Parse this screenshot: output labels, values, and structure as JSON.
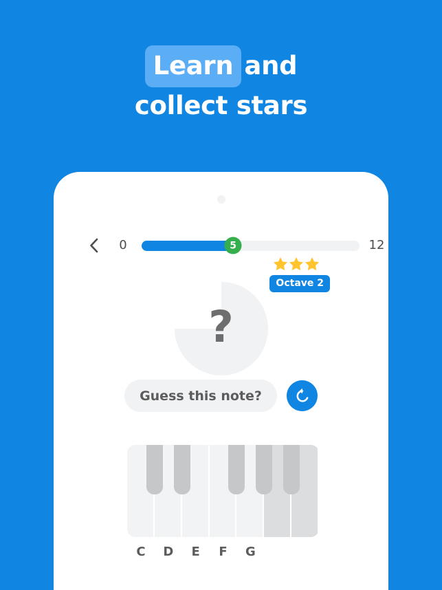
{
  "theme": {
    "background_blue": "#1085E2",
    "highlight_blue": "#5BAEF5",
    "green": "#35AF4E",
    "star_gold": "#FFC42E",
    "key_gray": "#F2F3F5",
    "key_locked_gray": "#DCDDDE",
    "black_key_gray": "#C6C7C8",
    "text_gray": "#5C5C5C"
  },
  "headline": {
    "highlight_word": "Learn",
    "line1_rest": "and",
    "line2": "collect stars"
  },
  "app": {
    "back_icon": "chevron-left-icon",
    "progress": {
      "min_label": "0",
      "max_label": "12",
      "value_label": "5",
      "value": 5,
      "min": 0,
      "max": 12,
      "fill_percent": 42
    },
    "stars": {
      "icon": "star-icon",
      "count": 3,
      "filled": 3
    },
    "octave_badge": "Octave 2",
    "note_display": {
      "symbol": "?",
      "pie_filled_fraction": 0.75
    },
    "guess_button": "Guess this note?",
    "replay_icon": "replay-icon",
    "piano": {
      "white_keys": [
        {
          "label": "C",
          "locked": false
        },
        {
          "label": "D",
          "locked": false
        },
        {
          "label": "E",
          "locked": false
        },
        {
          "label": "F",
          "locked": false
        },
        {
          "label": "G",
          "locked": false
        },
        {
          "label": "",
          "locked": true
        },
        {
          "label": "",
          "locked": true
        }
      ],
      "black_key_count": 5
    }
  }
}
